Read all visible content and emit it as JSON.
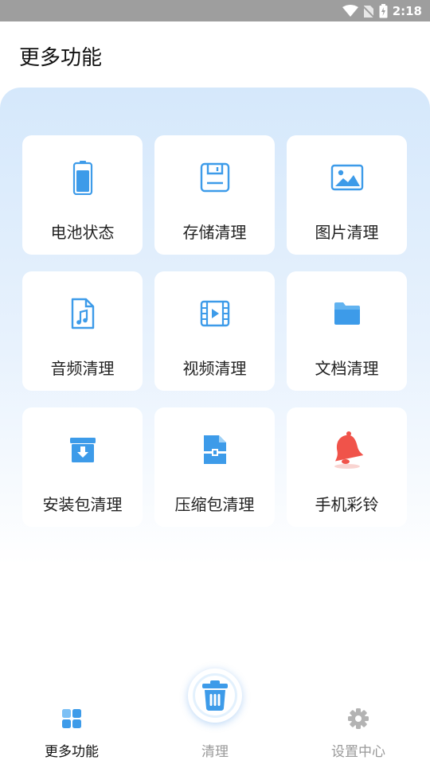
{
  "status_bar": {
    "time": "2:18"
  },
  "header": {
    "title": "更多功能"
  },
  "features": [
    {
      "label": "电池状态",
      "icon": "battery-icon"
    },
    {
      "label": "存储清理",
      "icon": "storage-icon"
    },
    {
      "label": "图片清理",
      "icon": "image-icon"
    },
    {
      "label": "音频清理",
      "icon": "audio-file-icon"
    },
    {
      "label": "视频清理",
      "icon": "video-icon"
    },
    {
      "label": "文档清理",
      "icon": "folder-icon"
    },
    {
      "label": "安装包清理",
      "icon": "package-icon"
    },
    {
      "label": "压缩包清理",
      "icon": "zip-icon"
    },
    {
      "label": "手机彩铃",
      "icon": "bell-icon"
    }
  ],
  "bottom_nav": {
    "items": [
      {
        "label": "更多功能",
        "icon": "grid-icon",
        "active": true
      },
      {
        "label": "清理",
        "icon": "trash-icon",
        "active": false
      },
      {
        "label": "设置中心",
        "icon": "gear-icon",
        "active": false
      }
    ]
  },
  "colors": {
    "accent": "#3d9be9",
    "bell": "#f0534a",
    "panel_gradient_top": "#d5e8fb",
    "active_text": "#111111",
    "inactive_text": "#999999"
  }
}
